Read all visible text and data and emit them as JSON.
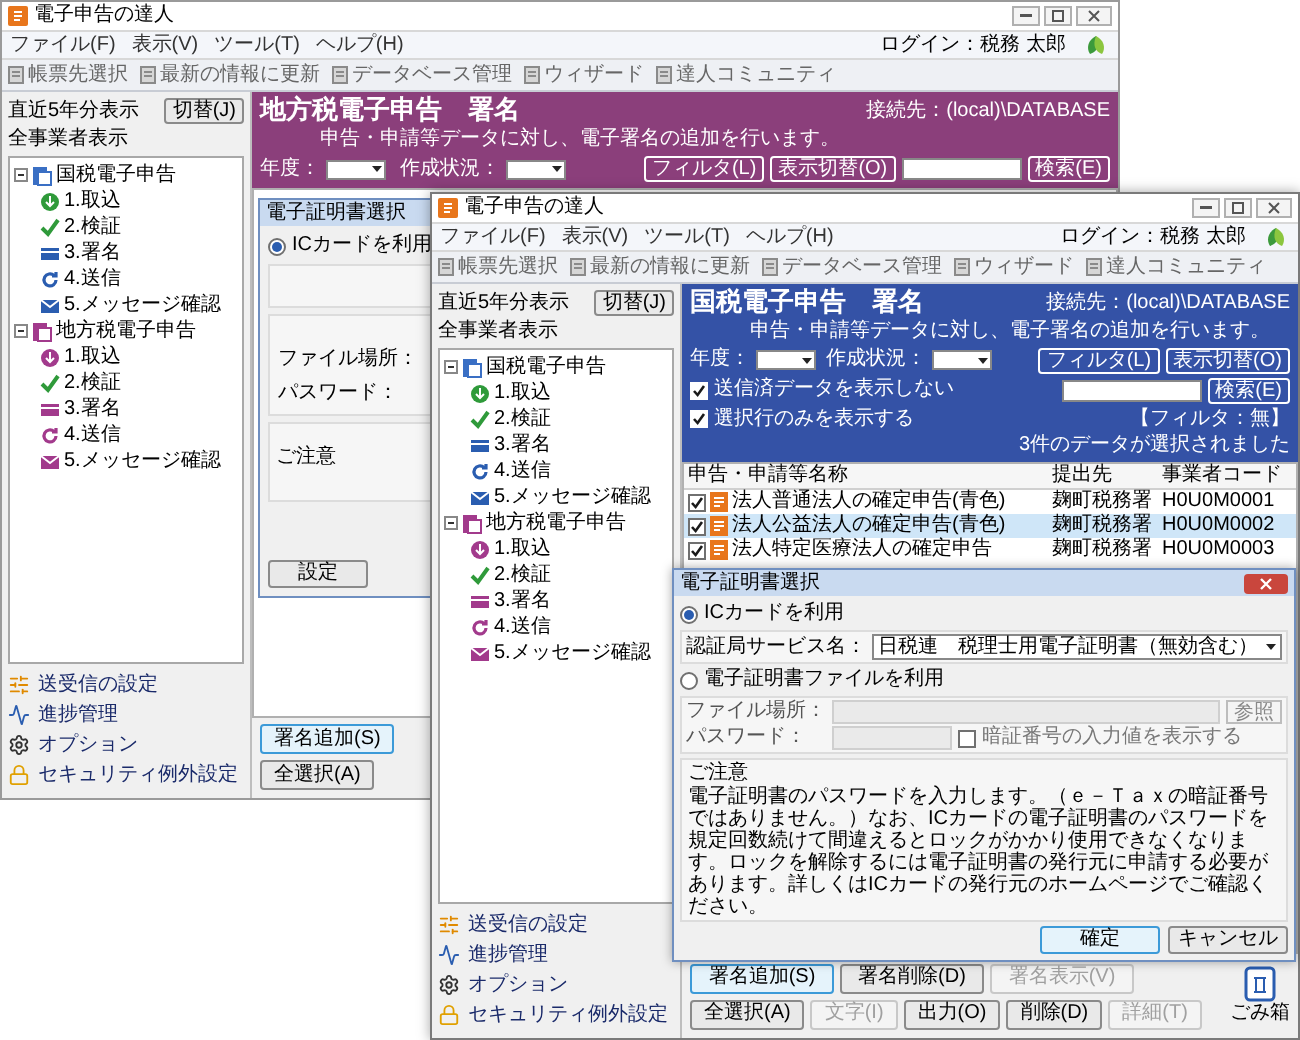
{
  "back_window": {
    "title": "電子申告の達人",
    "menu": [
      "ファイル(F)",
      "表示(V)",
      "ツール(T)",
      "ヘルプ(H)"
    ],
    "toolbar": [
      "帳票先選択",
      "最新の情報に更新",
      "データベース管理",
      "ウィザード",
      "達人コミュニティ"
    ],
    "login": "ログイン：税務 太郎",
    "sidebar": {
      "period": "直近5年分表示",
      "switch_button": "切替(J)",
      "scope": "全事業者表示",
      "tree": [
        {
          "label": "国税電子申告",
          "expanded": true,
          "children": [
            {
              "label": "1.取込"
            },
            {
              "label": "2.検証"
            },
            {
              "label": "3.署名"
            },
            {
              "label": "4.送信"
            },
            {
              "label": "5.メッセージ確認"
            }
          ]
        },
        {
          "label": "地方税電子申告",
          "expanded": true,
          "children": [
            {
              "label": "1.取込"
            },
            {
              "label": "2.検証"
            },
            {
              "label": "3.署名"
            },
            {
              "label": "4.送信"
            },
            {
              "label": "5.メッセージ確認"
            }
          ]
        }
      ],
      "links": [
        "送受信の設定",
        "進捗管理",
        "オプション",
        "セキュリティ例外設定"
      ]
    },
    "header": {
      "title": "地方税電子申告　署名",
      "connection": "接続先：(local)\\DATABASE",
      "subtitle": "申告・申請等データに対し、電子署名の追加を行います。",
      "year_label": "年度：",
      "status_label": "作成状況：",
      "filter_button": "フィルタ(L)",
      "view_button": "表示切替(O)",
      "search_button": "検索(E)"
    },
    "dialog": {
      "title": "電子証明書選択",
      "ic_option": {
        "label": "ICカードを利用",
        "selected": true
      },
      "file_label": "ファイル場所：",
      "password_label": "パスワード：",
      "notice_title": "ご注意",
      "ok_button": "設定"
    },
    "buttons": [
      {
        "label": "署名追加(S)",
        "default": true,
        "disabled": false
      },
      {
        "label": "全選択(A)",
        "default": false,
        "disabled": false
      }
    ]
  },
  "front_window": {
    "title": "電子申告の達人",
    "menu": [
      "ファイル(F)",
      "表示(V)",
      "ツール(T)",
      "ヘルプ(H)"
    ],
    "toolbar": [
      "帳票先選択",
      "最新の情報に更新",
      "データベース管理",
      "ウィザード",
      "達人コミュニティ"
    ],
    "login": "ログイン：税務 太郎",
    "sidebar": {
      "period": "直近5年分表示",
      "switch_button": "切替(J)",
      "scope": "全事業者表示",
      "tree": [
        {
          "label": "国税電子申告",
          "expanded": true,
          "children": [
            {
              "label": "1.取込"
            },
            {
              "label": "2.検証"
            },
            {
              "label": "3.署名"
            },
            {
              "label": "4.送信"
            },
            {
              "label": "5.メッセージ確認"
            }
          ]
        },
        {
          "label": "地方税電子申告",
          "expanded": true,
          "children": [
            {
              "label": "1.取込"
            },
            {
              "label": "2.検証"
            },
            {
              "label": "3.署名"
            },
            {
              "label": "4.送信"
            },
            {
              "label": "5.メッセージ確認"
            }
          ]
        }
      ],
      "links": [
        "送受信の設定",
        "進捗管理",
        "オプション",
        "セキュリティ例外設定"
      ]
    },
    "header": {
      "title": "国税電子申告　署名",
      "connection": "接続先：(local)\\DATABASE",
      "subtitle": "申告・申請等データに対し、電子署名の追加を行います。",
      "year_label": "年度：",
      "status_label": "作成状況：",
      "filter_button": "フィルタ(L)",
      "view_button": "表示切替(O)",
      "search_button": "検索(E)",
      "hide_sent": {
        "label": "送信済データを表示しない",
        "checked": true
      },
      "selected_only": {
        "label": "選択行のみを表示する",
        "checked": true
      },
      "filter_status": "【フィルタ：無】",
      "selection_count": "3件のデータが選択されました"
    },
    "table": {
      "columns": [
        "申告・申請等名称",
        "提出先",
        "事業者コード"
      ],
      "rows": [
        {
          "checked": true,
          "selected": false,
          "name": "法人普通法人の確定申告(青色)",
          "office": "麹町税務署",
          "code": "H0U0M0001"
        },
        {
          "checked": true,
          "selected": true,
          "name": "法人公益法人の確定申告(青色)",
          "office": "麹町税務署",
          "code": "H0U0M0002"
        },
        {
          "checked": true,
          "selected": false,
          "name": "法人特定医療法人の確定申告",
          "office": "麹町税務署",
          "code": "H0U0M0003"
        }
      ]
    },
    "dialog": {
      "title": "電子証明書選択",
      "options": [
        {
          "label": "ICカードを利用",
          "selected": true
        },
        {
          "label": "電子証明書ファイルを利用",
          "selected": false
        }
      ],
      "service_label": "認証局サービス名：",
      "service_value": "日税連　税理士用電子証明書（無効含む）",
      "file_label": "ファイル場所：",
      "browse_button": "参照",
      "password_label": "パスワード：",
      "show_pin": {
        "label": "暗証番号の入力値を表示する",
        "checked": false
      },
      "notice_title": "ご注意",
      "notice": "電子証明書のパスワードを入力します。（ｅ－Ｔａｘの暗証番号ではありません。）なお、ICカードの電子証明書のパスワードを規定回数続けて間違えるとロックがかかり使用できなくなります。ロックを解除するには電子証明書の発行元に申請する必要があります。詳しくはICカードの発行元のホームページでご確認ください。",
      "ok_button": "確定",
      "cancel_button": "キャンセル"
    },
    "buttons": [
      [
        {
          "label": "署名追加(S)",
          "default": true,
          "disabled": false
        },
        {
          "label": "署名削除(D)",
          "default": false,
          "disabled": false
        },
        {
          "label": "署名表示(V)",
          "default": false,
          "disabled": true
        }
      ],
      [
        {
          "label": "全選択(A)",
          "default": false,
          "disabled": false
        },
        {
          "label": "文字(I)",
          "default": false,
          "disabled": true
        },
        {
          "label": "出力(O)",
          "default": false,
          "disabled": false
        },
        {
          "label": "削除(D)",
          "default": false,
          "disabled": false
        },
        {
          "label": "詳細(T)",
          "default": false,
          "disabled": true
        }
      ]
    ],
    "trash": "ごみ箱"
  }
}
